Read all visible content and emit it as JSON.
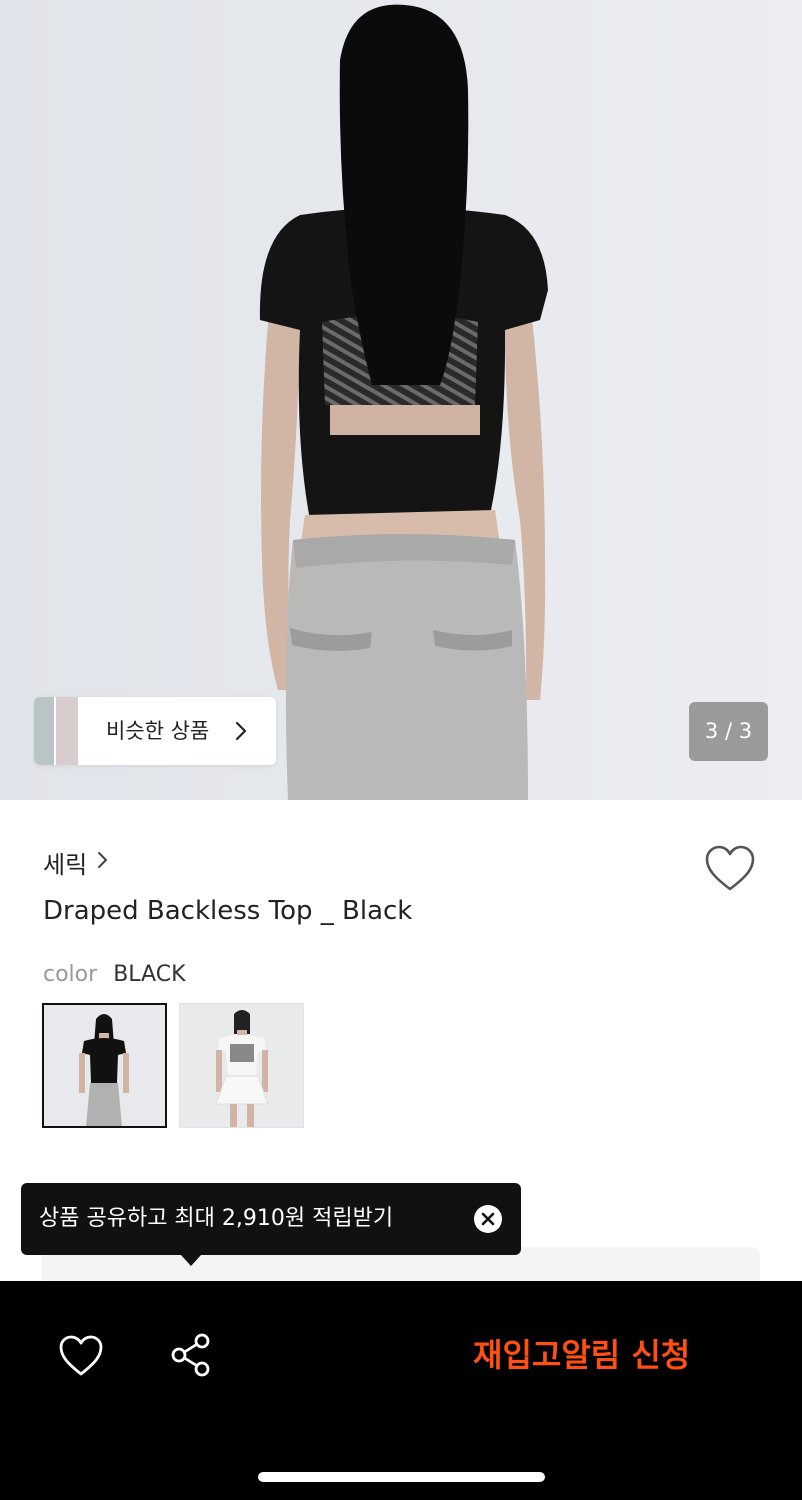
{
  "hero": {
    "similar_label": "비슷한 상품",
    "counter": "3 / 3",
    "current_image": 3,
    "total_images": 3
  },
  "product": {
    "brand": "세릭",
    "title": "Draped Backless Top _ Black",
    "color_label": "color",
    "color_value": "BLACK"
  },
  "tooltip": {
    "text": "상품 공유하고 최대 2,910원 적립받기"
  },
  "bottom_bar": {
    "restock_label": "재입고알림 신청"
  },
  "colors": {
    "accent": "#ff4f12",
    "bar_bg": "#000000",
    "tooltip_bg": "#111111"
  },
  "icons": [
    "chevron-right-icon",
    "heart-outline-icon",
    "close-circle-icon",
    "share-icon"
  ]
}
